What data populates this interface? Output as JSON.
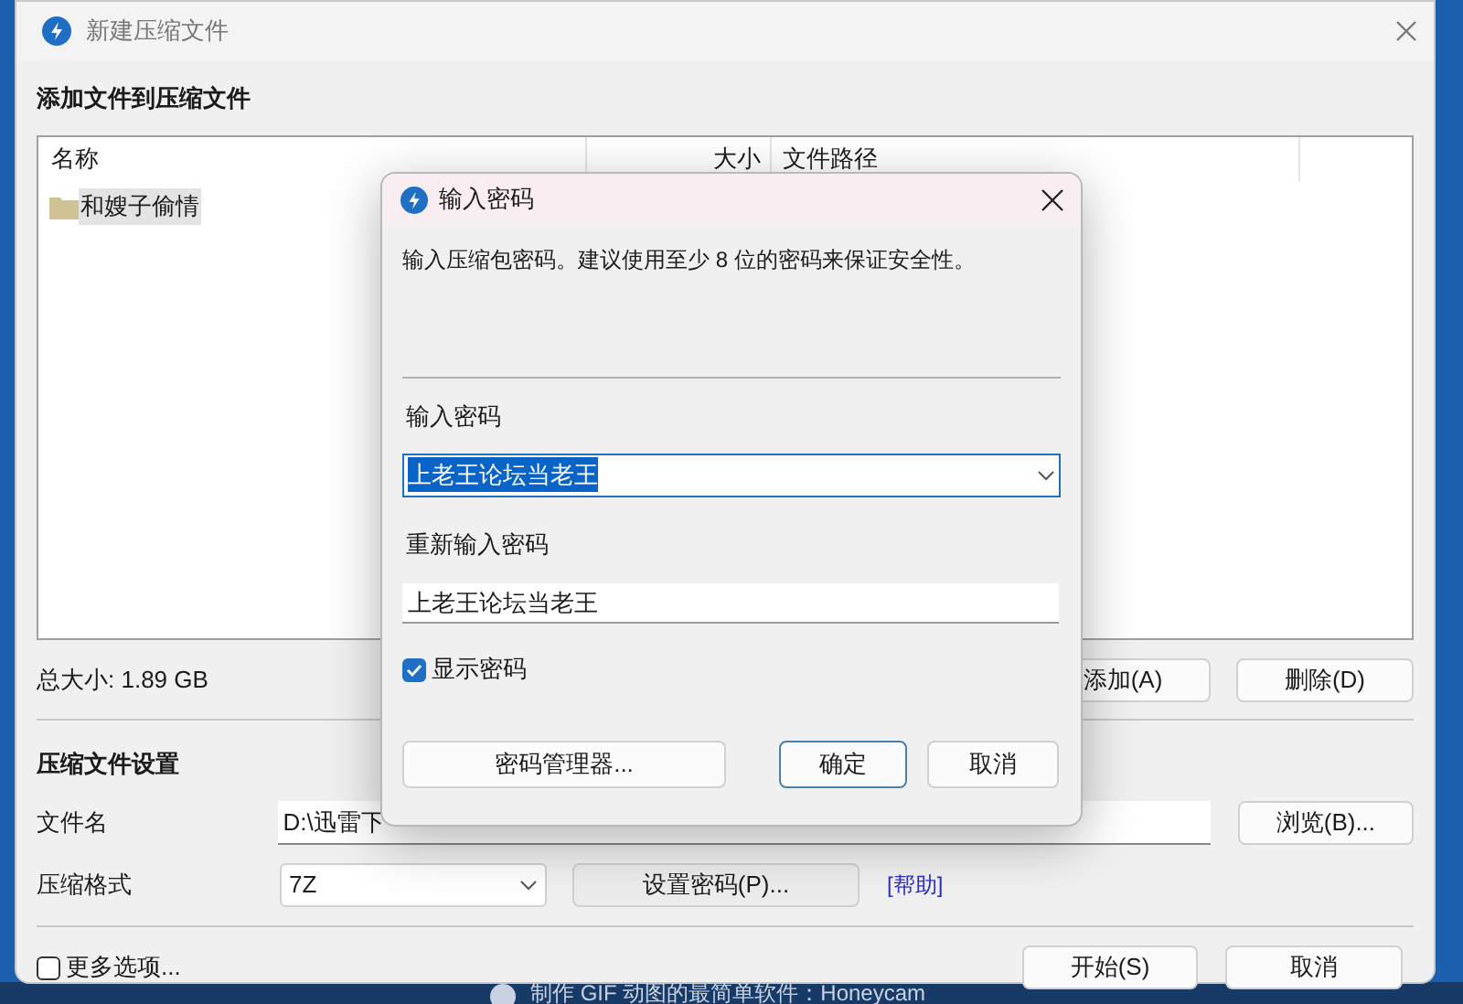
{
  "background": {
    "caption": "制作 GIF 动图的最简单软件：Honeycam"
  },
  "main_window": {
    "title": "新建压缩文件",
    "section_title": "添加文件到压缩文件",
    "file_list": {
      "columns": [
        "名称",
        "大小",
        "文件路径"
      ],
      "rows": [
        {
          "name": "和嫂子偷情",
          "selected": true
        }
      ]
    },
    "total_size": "总大小: 1.89 GB",
    "add_button": "添加(A)",
    "delete_button": "删除(D)",
    "settings_title": "压缩文件设置",
    "filename_label": "文件名",
    "filename_value": "D:\\迅雷下",
    "browse_button": "浏览(B)...",
    "format_label": "压缩格式",
    "format_value": "7Z",
    "set_password_button": "设置密码(P)...",
    "help_link": "[帮助]",
    "more_options": {
      "label": "更多选项...",
      "checked": false
    },
    "start_button": "开始(S)",
    "cancel_button": "取消"
  },
  "password_dialog": {
    "title": "输入密码",
    "hint": "输入压缩包密码。建议使用至少 8 位的密码来保证安全性。",
    "password_label": "输入密码",
    "password_value": "上老王论坛当老王",
    "retype_label": "重新输入密码",
    "retype_value": "上老王论坛当老王",
    "show_password": {
      "label": "显示密码",
      "checked": true
    },
    "manager_button": "密码管理器...",
    "ok_button": "确定",
    "cancel_button": "取消"
  }
}
